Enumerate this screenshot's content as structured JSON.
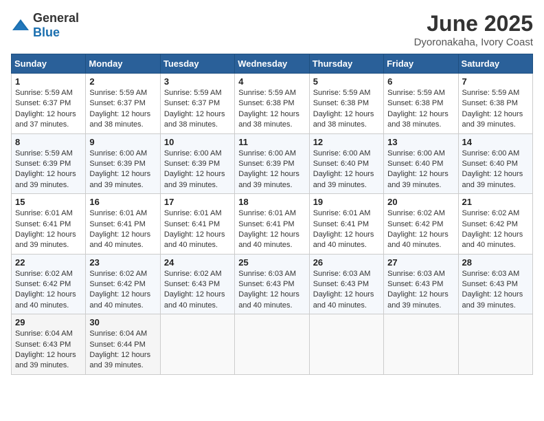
{
  "header": {
    "logo_general": "General",
    "logo_blue": "Blue",
    "month_title": "June 2025",
    "location": "Dyoronakaha, Ivory Coast"
  },
  "weekdays": [
    "Sunday",
    "Monday",
    "Tuesday",
    "Wednesday",
    "Thursday",
    "Friday",
    "Saturday"
  ],
  "weeks": [
    [
      {
        "day": "1",
        "sunrise": "5:59 AM",
        "sunset": "6:37 PM",
        "daylight": "12 hours and 37 minutes."
      },
      {
        "day": "2",
        "sunrise": "5:59 AM",
        "sunset": "6:37 PM",
        "daylight": "12 hours and 38 minutes."
      },
      {
        "day": "3",
        "sunrise": "5:59 AM",
        "sunset": "6:37 PM",
        "daylight": "12 hours and 38 minutes."
      },
      {
        "day": "4",
        "sunrise": "5:59 AM",
        "sunset": "6:38 PM",
        "daylight": "12 hours and 38 minutes."
      },
      {
        "day": "5",
        "sunrise": "5:59 AM",
        "sunset": "6:38 PM",
        "daylight": "12 hours and 38 minutes."
      },
      {
        "day": "6",
        "sunrise": "5:59 AM",
        "sunset": "6:38 PM",
        "daylight": "12 hours and 38 minutes."
      },
      {
        "day": "7",
        "sunrise": "5:59 AM",
        "sunset": "6:38 PM",
        "daylight": "12 hours and 39 minutes."
      }
    ],
    [
      {
        "day": "8",
        "sunrise": "5:59 AM",
        "sunset": "6:39 PM",
        "daylight": "12 hours and 39 minutes."
      },
      {
        "day": "9",
        "sunrise": "6:00 AM",
        "sunset": "6:39 PM",
        "daylight": "12 hours and 39 minutes."
      },
      {
        "day": "10",
        "sunrise": "6:00 AM",
        "sunset": "6:39 PM",
        "daylight": "12 hours and 39 minutes."
      },
      {
        "day": "11",
        "sunrise": "6:00 AM",
        "sunset": "6:39 PM",
        "daylight": "12 hours and 39 minutes."
      },
      {
        "day": "12",
        "sunrise": "6:00 AM",
        "sunset": "6:40 PM",
        "daylight": "12 hours and 39 minutes."
      },
      {
        "day": "13",
        "sunrise": "6:00 AM",
        "sunset": "6:40 PM",
        "daylight": "12 hours and 39 minutes."
      },
      {
        "day": "14",
        "sunrise": "6:00 AM",
        "sunset": "6:40 PM",
        "daylight": "12 hours and 39 minutes."
      }
    ],
    [
      {
        "day": "15",
        "sunrise": "6:01 AM",
        "sunset": "6:41 PM",
        "daylight": "12 hours and 39 minutes."
      },
      {
        "day": "16",
        "sunrise": "6:01 AM",
        "sunset": "6:41 PM",
        "daylight": "12 hours and 40 minutes."
      },
      {
        "day": "17",
        "sunrise": "6:01 AM",
        "sunset": "6:41 PM",
        "daylight": "12 hours and 40 minutes."
      },
      {
        "day": "18",
        "sunrise": "6:01 AM",
        "sunset": "6:41 PM",
        "daylight": "12 hours and 40 minutes."
      },
      {
        "day": "19",
        "sunrise": "6:01 AM",
        "sunset": "6:41 PM",
        "daylight": "12 hours and 40 minutes."
      },
      {
        "day": "20",
        "sunrise": "6:02 AM",
        "sunset": "6:42 PM",
        "daylight": "12 hours and 40 minutes."
      },
      {
        "day": "21",
        "sunrise": "6:02 AM",
        "sunset": "6:42 PM",
        "daylight": "12 hours and 40 minutes."
      }
    ],
    [
      {
        "day": "22",
        "sunrise": "6:02 AM",
        "sunset": "6:42 PM",
        "daylight": "12 hours and 40 minutes."
      },
      {
        "day": "23",
        "sunrise": "6:02 AM",
        "sunset": "6:42 PM",
        "daylight": "12 hours and 40 minutes."
      },
      {
        "day": "24",
        "sunrise": "6:02 AM",
        "sunset": "6:43 PM",
        "daylight": "12 hours and 40 minutes."
      },
      {
        "day": "25",
        "sunrise": "6:03 AM",
        "sunset": "6:43 PM",
        "daylight": "12 hours and 40 minutes."
      },
      {
        "day": "26",
        "sunrise": "6:03 AM",
        "sunset": "6:43 PM",
        "daylight": "12 hours and 40 minutes."
      },
      {
        "day": "27",
        "sunrise": "6:03 AM",
        "sunset": "6:43 PM",
        "daylight": "12 hours and 39 minutes."
      },
      {
        "day": "28",
        "sunrise": "6:03 AM",
        "sunset": "6:43 PM",
        "daylight": "12 hours and 39 minutes."
      }
    ],
    [
      {
        "day": "29",
        "sunrise": "6:04 AM",
        "sunset": "6:43 PM",
        "daylight": "12 hours and 39 minutes."
      },
      {
        "day": "30",
        "sunrise": "6:04 AM",
        "sunset": "6:44 PM",
        "daylight": "12 hours and 39 minutes."
      },
      null,
      null,
      null,
      null,
      null
    ]
  ],
  "labels": {
    "sunrise": "Sunrise:",
    "sunset": "Sunset:",
    "daylight": "Daylight:"
  }
}
